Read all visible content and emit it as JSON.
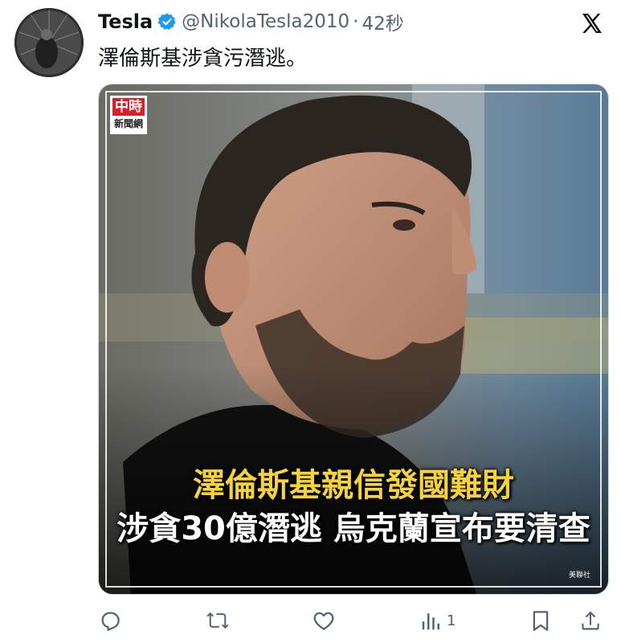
{
  "tweet": {
    "display_name": "Tesla",
    "handle": "@NikolaTesla2010",
    "separator": "·",
    "timestamp": "42秒",
    "text": "澤倫斯基涉貪污潛逃。",
    "verified": true,
    "verified_color": "#1d9bf0"
  },
  "media": {
    "logo_top": "中時",
    "logo_bottom": "新聞網",
    "headline_line1": "澤倫斯基親信發國難財",
    "headline_line2": "涉貪30億潛逃 烏克蘭宣布要清查",
    "headline_line1_color": "#f6d33b",
    "credit": "美聯社"
  },
  "actions": {
    "reply_icon": "reply-icon",
    "retweet_icon": "retweet-icon",
    "like_icon": "like-icon",
    "views_icon": "views-icon",
    "views_count": "1",
    "bookmark_icon": "bookmark-icon",
    "share_icon": "share-icon"
  },
  "colors": {
    "text_primary": "#0f1419",
    "text_secondary": "#536471",
    "logo_red": "#d6202a"
  }
}
